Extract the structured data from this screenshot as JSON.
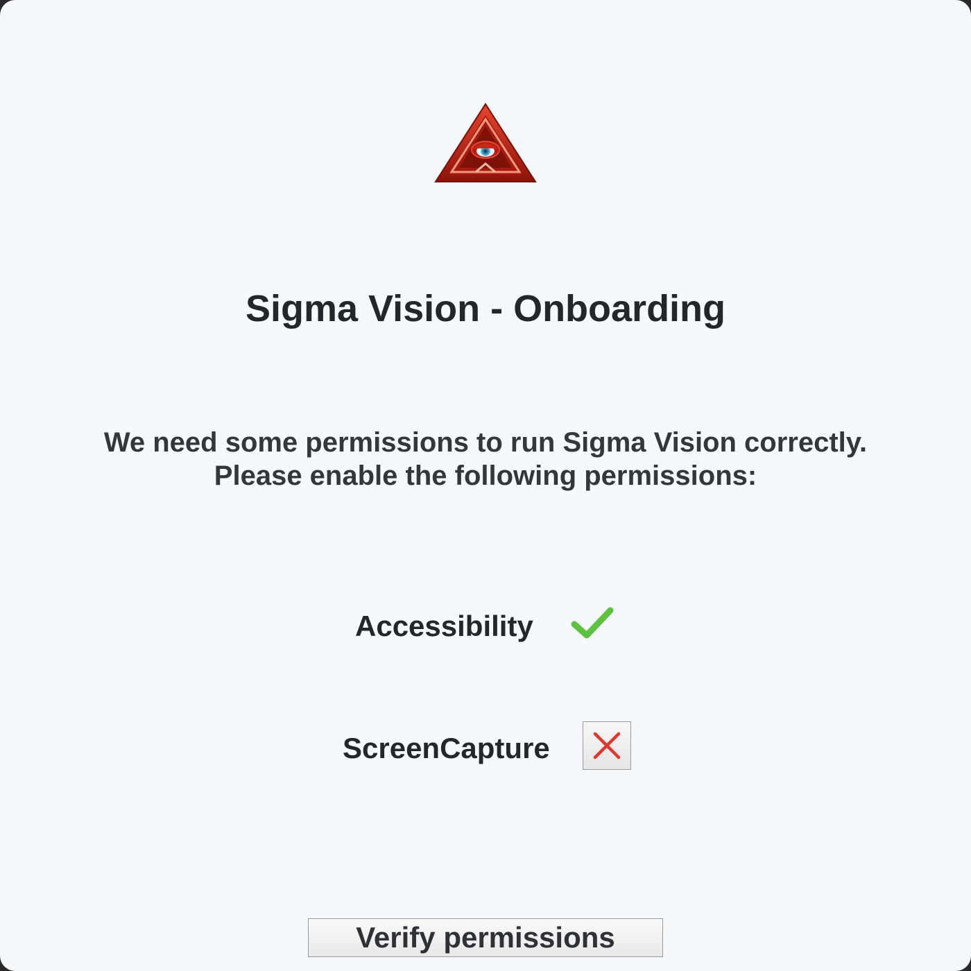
{
  "window": {
    "title": "Sigma Vision - Onboarding",
    "logo_icon": "eye-pyramid-icon"
  },
  "intro": {
    "line1": "We need some permissions to run Sigma Vision correctly.",
    "line2": "Please enable the following permissions:"
  },
  "permissions": [
    {
      "label": "Accessibility",
      "status": "granted",
      "status_icon": "checkmark-icon",
      "status_color": "#5cc23f"
    },
    {
      "label": "ScreenCapture",
      "status": "denied",
      "status_icon": "close-icon",
      "status_color": "#e0362b"
    }
  ],
  "actions": {
    "verify_label": "Verify permissions"
  },
  "colors": {
    "background": "#f5f8fc",
    "text": "#23262b",
    "logo_red": "#c8261a"
  }
}
